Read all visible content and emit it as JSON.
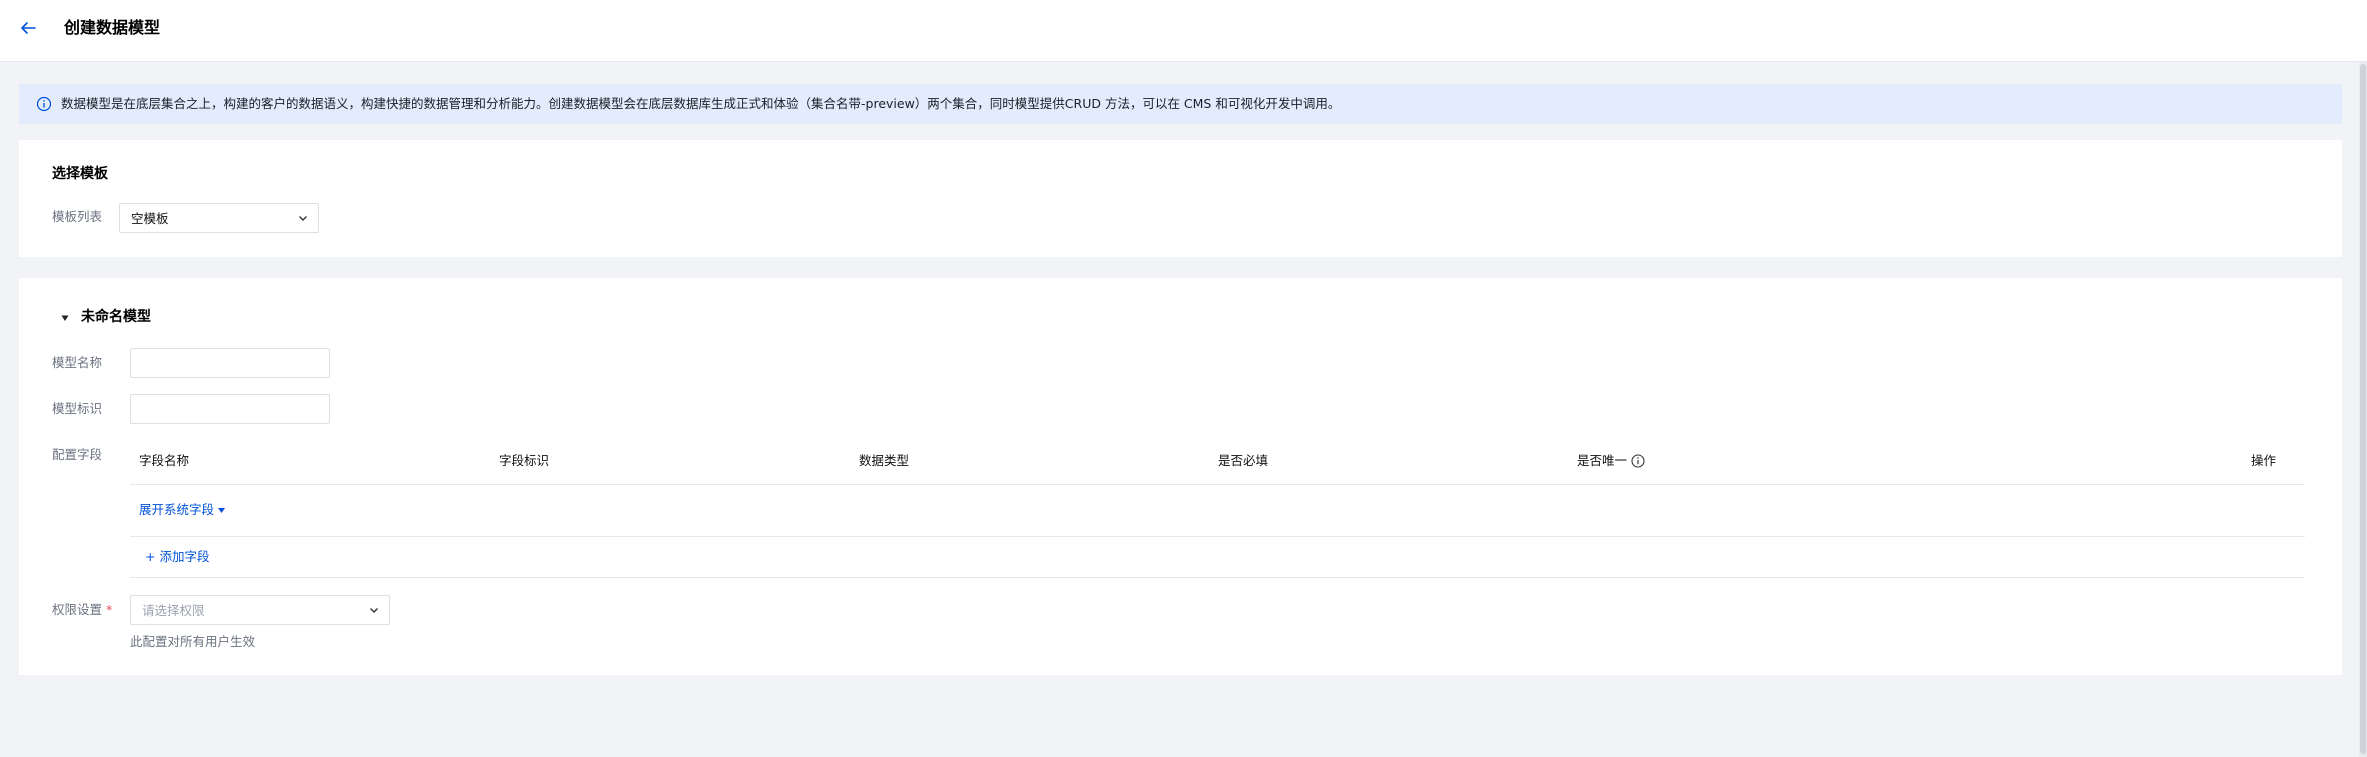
{
  "header": {
    "title": "创建数据模型"
  },
  "notice": {
    "text": "数据模型是在底层集合之上，构建的客户的数据语义，构建快捷的数据管理和分析能力。创建数据模型会在底层数据库生成正式和体验（集合名带-preview）两个集合，同时模型提供CRUD 方法，可以在 CMS 和可视化开发中调用。"
  },
  "template_section": {
    "title": "选择模板",
    "label": "模板列表",
    "selected": "空模板"
  },
  "model_section": {
    "title": "未命名模型",
    "name_label": "模型名称",
    "name_value": "",
    "id_label": "模型标识",
    "id_value": "",
    "fields_label": "配置字段",
    "columns": [
      "字段名称",
      "字段标识",
      "数据类型",
      "是否必填",
      "是否唯一",
      "操作"
    ],
    "expand_system_fields": "展开系统字段",
    "add_field": "+ 添加字段",
    "permission_label": "权限设置",
    "required_mark": "*",
    "permission_placeholder": "请选择权限",
    "permission_hint": "此配置对所有用户生效"
  },
  "colors": {
    "accent": "#0052d9",
    "notice_bg": "#e3ecfd",
    "page_bg": "#f2f3f7"
  }
}
